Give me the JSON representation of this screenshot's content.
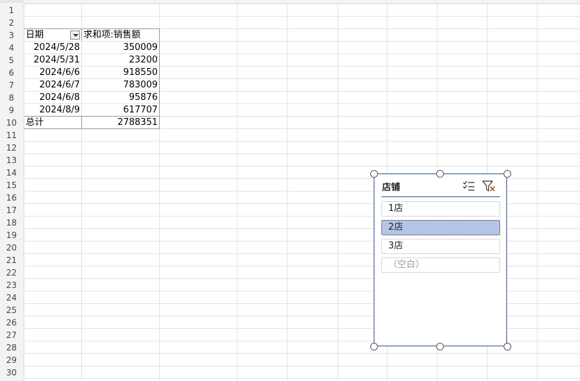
{
  "rows": [
    "1",
    "2",
    "3",
    "4",
    "5",
    "6",
    "7",
    "8",
    "9",
    "10",
    "11",
    "12",
    "13",
    "14",
    "15",
    "16",
    "17",
    "18",
    "19",
    "20",
    "21",
    "22",
    "23",
    "24",
    "25",
    "26",
    "27",
    "28",
    "29",
    "30"
  ],
  "pivot": {
    "header_date": "日期",
    "header_sum": "求和项:销售额",
    "data": [
      {
        "date": "2024/5/28",
        "value": "350009"
      },
      {
        "date": "2024/5/31",
        "value": "23200"
      },
      {
        "date": "2024/6/6",
        "value": "918550"
      },
      {
        "date": "2024/6/7",
        "value": "783009"
      },
      {
        "date": "2024/6/8",
        "value": "95876"
      },
      {
        "date": "2024/8/9",
        "value": "617707"
      }
    ],
    "total_label": "总计",
    "total_value": "2788351"
  },
  "slicer": {
    "title": "店铺",
    "items": [
      {
        "label": "1店",
        "selected": false
      },
      {
        "label": "2店",
        "selected": true
      },
      {
        "label": "3店",
        "selected": false
      },
      {
        "label": "（空白）",
        "selected": false
      }
    ]
  },
  "colors": {
    "accent": "#2f5597",
    "selected_fill": "#b4c6e7",
    "clear_filter_x": "#c0392b"
  }
}
